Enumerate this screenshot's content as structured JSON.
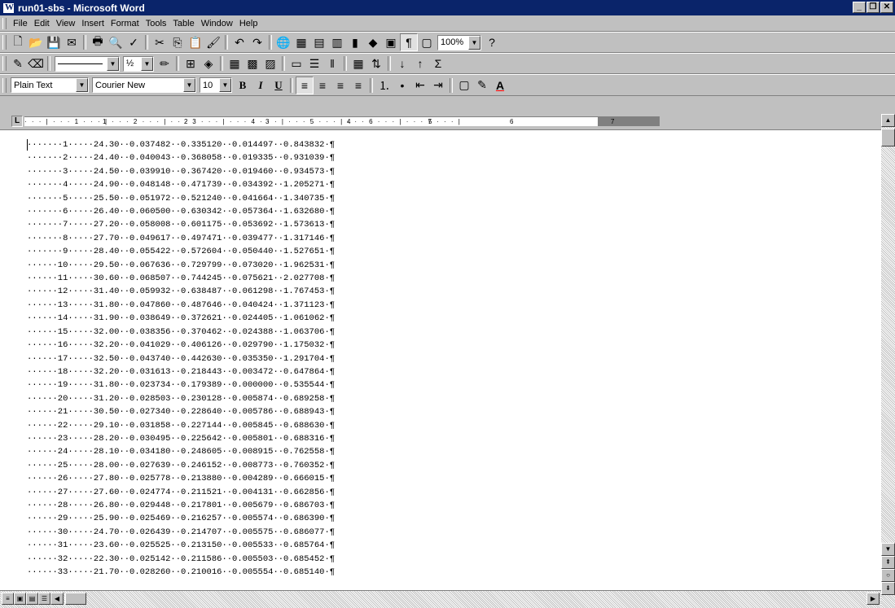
{
  "window": {
    "title": "run01-sbs - Microsoft Word",
    "minimize": "_",
    "restore": "❐",
    "close": "✕"
  },
  "menu": [
    "File",
    "Edit",
    "View",
    "Insert",
    "Format",
    "Tools",
    "Table",
    "Window",
    "Help"
  ],
  "toolbar_standard": {
    "zoom": "100%"
  },
  "toolbar_formatting": {
    "style": "Plain Text",
    "font": "Courier New",
    "size": "10",
    "bold": "B",
    "italic": "I",
    "underline": "U"
  },
  "toolbar_drawing": {
    "line_width": "½"
  },
  "ruler": {
    "numbers": [
      "1",
      "2",
      "3",
      "4",
      "5",
      "6",
      "7"
    ]
  },
  "document": {
    "lines": [
      "·······1·····24.30··0.037482··0.335120··0.014497··0.843832·¶",
      "·······2·····24.40··0.040043··0.368058··0.019335··0.931039·¶",
      "·······3·····24.50··0.039910··0.367420··0.019460··0.934573·¶",
      "·······4·····24.90··0.048148··0.471739··0.034392··1.205271·¶",
      "·······5·····25.50··0.051972··0.521240··0.041664··1.340735·¶",
      "·······6·····26.40··0.060500··0.630342··0.057364··1.632680·¶",
      "·······7·····27.20··0.058008··0.601175··0.053692··1.573613·¶",
      "·······8·····27.70··0.049617··0.497471··0.039477··1.317146·¶",
      "·······9·····28.40··0.055422··0.572604··0.050440··1.527651·¶",
      "······10·····29.50··0.067636··0.729799··0.073020··1.962531·¶",
      "······11·····30.60··0.068507··0.744245··0.075621··2.027708·¶",
      "······12·····31.40··0.059932··0.638487··0.061298··1.767453·¶",
      "······13·····31.80··0.047860··0.487646··0.040424··1.371123·¶",
      "······14·····31.90··0.038649··0.372621··0.024405··1.061062·¶",
      "······15·····32.00··0.038356··0.370462··0.024388··1.063706·¶",
      "······16·····32.20··0.041029··0.406126··0.029790··1.175032·¶",
      "······17·····32.50··0.043740··0.442630··0.035350··1.291704·¶",
      "······18·····32.20··0.031613··0.218443··0.003472··0.647864·¶",
      "······19·····31.80··0.023734··0.179389··0.000000··0.535544·¶",
      "······20·····31.20··0.028503··0.230128··0.005874··0.689258·¶",
      "······21·····30.50··0.027340··0.228640··0.005786··0.688943·¶",
      "······22·····29.10··0.031858··0.227144··0.005845··0.688630·¶",
      "······23·····28.20··0.030495··0.225642··0.005801··0.688316·¶",
      "······24·····28.10··0.034180··0.248605··0.008915··0.762558·¶",
      "······25·····28.00··0.027639··0.246152··0.008773··0.760352·¶",
      "······26·····27.80··0.025778··0.213880··0.004289··0.666015·¶",
      "······27·····27.60··0.024774··0.211521··0.004131··0.662856·¶",
      "······28·····26.80··0.029448··0.217801··0.005679··0.686703·¶",
      "······29·····25.90··0.025469··0.216257··0.005574··0.686390·¶",
      "······30·····24.70··0.026439··0.214707··0.005575··0.686077·¶",
      "······31·····23.60··0.025525··0.213150··0.005533··0.685764·¶",
      "······32·····22.30··0.025142··0.211586··0.005503··0.685452·¶",
      "······33·····21.70··0.028260··0.210016··0.005554··0.685140·¶"
    ]
  }
}
